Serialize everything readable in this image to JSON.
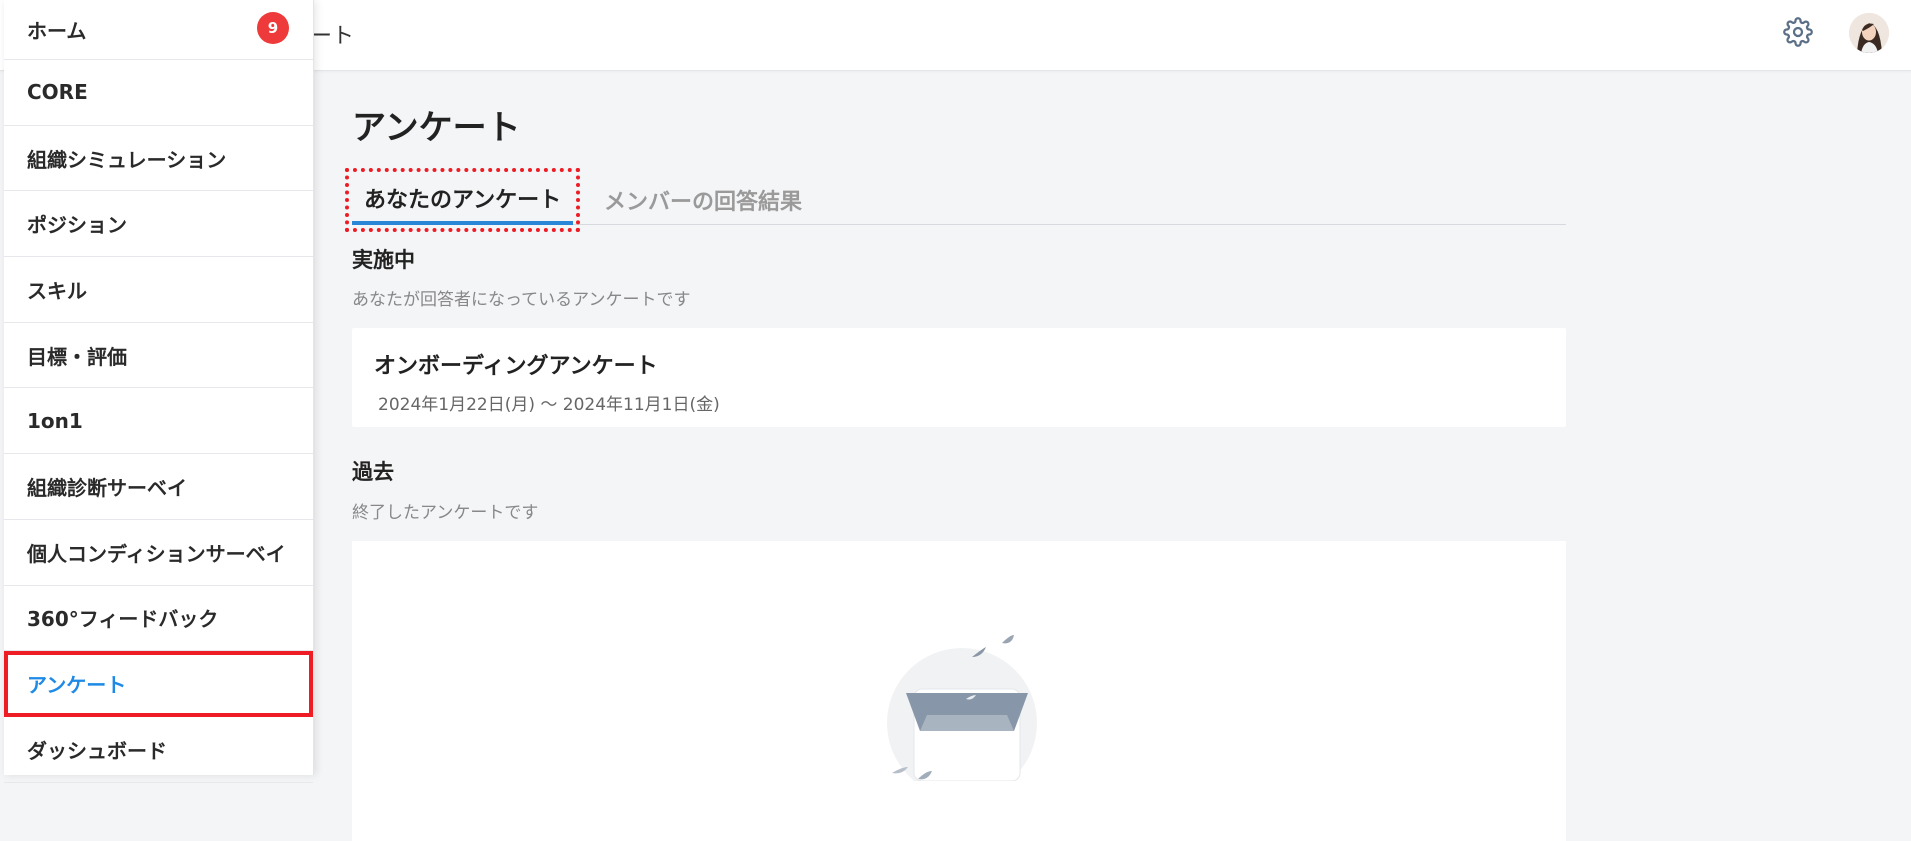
{
  "header": {
    "breadcrumb": "ート"
  },
  "sidebar": {
    "items": [
      {
        "label": "ホーム",
        "badge": "9"
      },
      {
        "label": "CORE"
      },
      {
        "label": "組織シミュレーション"
      },
      {
        "label": "ポジション"
      },
      {
        "label": "スキル"
      },
      {
        "label": "目標・評価"
      },
      {
        "label": "1on1"
      },
      {
        "label": "組織診断サーベイ"
      },
      {
        "label": "個人コンディションサーベイ"
      },
      {
        "label": "360°フィードバック"
      },
      {
        "label": "アンケート",
        "active": true
      },
      {
        "label": "ダッシュボード"
      }
    ]
  },
  "main": {
    "title": "アンケート",
    "tabs": [
      {
        "label": "あなたのアンケート",
        "active": true
      },
      {
        "label": "メンバーの回答結果"
      }
    ],
    "active_section": {
      "title": "実施中",
      "description": "あなたが回答者になっているアンケートです",
      "cards": [
        {
          "name": "オンボーディングアンケート",
          "period": "2024年1月22日(月) ～ 2024年11月1日(金)"
        }
      ]
    },
    "past_section": {
      "title": "過去",
      "description": "終了したアンケートです"
    }
  },
  "colors": {
    "accent": "#1f8ae6",
    "badge": "#ee3a3a",
    "highlight": "#ee1c24"
  },
  "icons": {
    "settings": "gear-icon",
    "empty_state": "empty-inbox-illustration"
  }
}
